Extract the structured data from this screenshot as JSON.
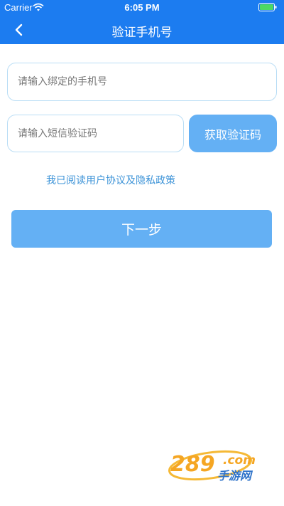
{
  "status_bar": {
    "carrier": "Carrier",
    "time": "6:05 PM",
    "wifi_icon": "wifi-icon",
    "battery_icon": "battery-icon"
  },
  "nav": {
    "title": "验证手机号",
    "back_icon": "chevron-left-icon"
  },
  "form": {
    "phone_placeholder": "请输入绑定的手机号",
    "phone_value": "",
    "code_placeholder": "请输入短信验证码",
    "code_value": "",
    "get_code_label": "获取验证码",
    "agreement_text": "我已阅读用户协议及隐私政策",
    "next_label": "下一步"
  },
  "watermark": {
    "text": "289手游网",
    "domain": ".com"
  },
  "colors": {
    "header_bg": "#1c7cf0",
    "button_bg": "#64b0f4",
    "input_border": "#b9ddf5",
    "link": "#3e94d8",
    "battery": "#4cd964"
  }
}
